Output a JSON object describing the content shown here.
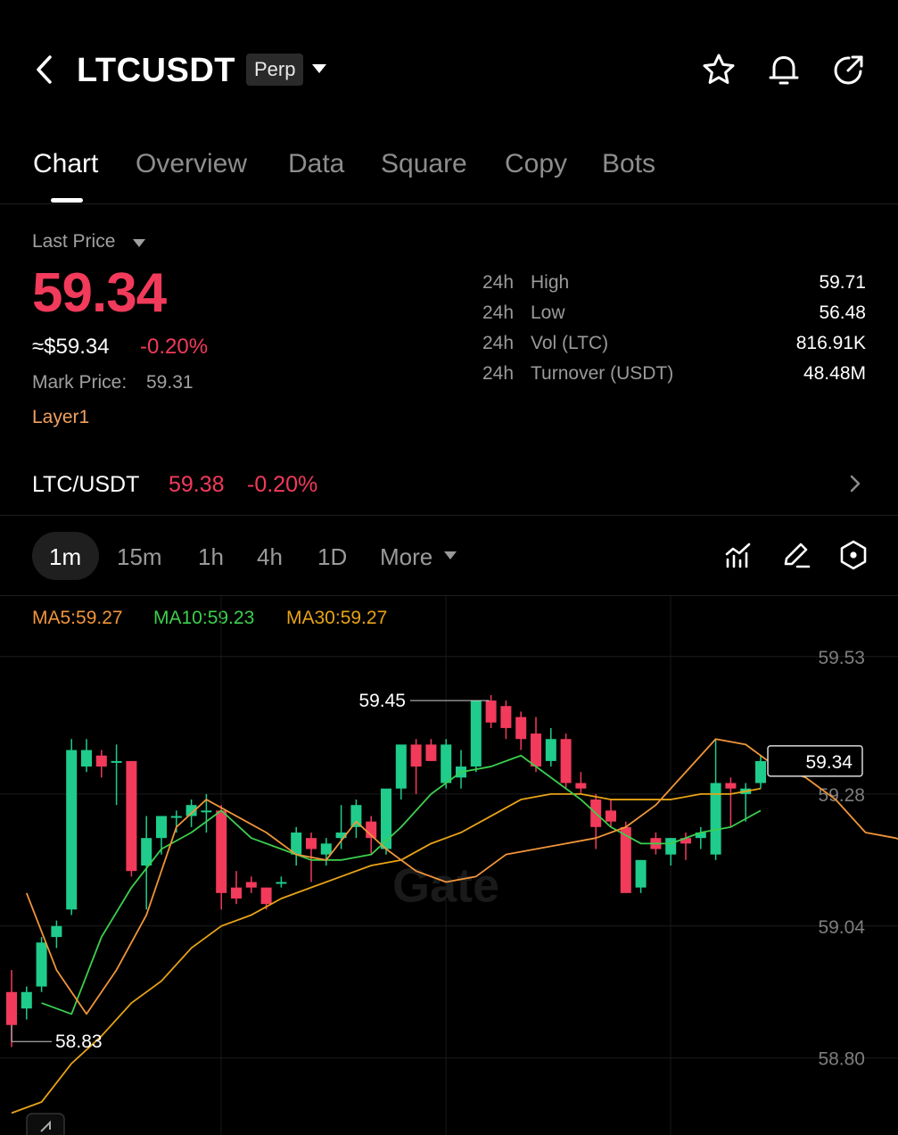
{
  "header": {
    "symbol": "LTCUSDT",
    "contract_type": "Perp",
    "icons": [
      "back-icon",
      "star-icon",
      "bell-icon",
      "share-icon"
    ]
  },
  "tabs": [
    {
      "label": "Chart",
      "active": true
    },
    {
      "label": "Overview",
      "active": false
    },
    {
      "label": "Data",
      "active": false
    },
    {
      "label": "Square",
      "active": false
    },
    {
      "label": "Copy",
      "active": false
    },
    {
      "label": "Bots",
      "active": false
    }
  ],
  "price": {
    "label": "Last Price",
    "last": "59.34",
    "usd": "≈$59.34",
    "change": "-0.20%",
    "mark_label": "Mark Price:",
    "mark_value": "59.31",
    "tag": "Layer1"
  },
  "stats": [
    {
      "prefix": "24h",
      "name": "High",
      "value": "59.71"
    },
    {
      "prefix": "24h",
      "name": "Low",
      "value": "56.48"
    },
    {
      "prefix": "24h",
      "name": "Vol (LTC)",
      "value": "816.91K"
    },
    {
      "prefix": "24h",
      "name": "Turnover (USDT)",
      "value": "48.48M"
    }
  ],
  "spot": {
    "pair": "LTC/USDT",
    "price": "59.38",
    "change": "-0.20%"
  },
  "intervals": [
    {
      "label": "1m",
      "active": true
    },
    {
      "label": "15m",
      "active": false
    },
    {
      "label": "1h",
      "active": false
    },
    {
      "label": "4h",
      "active": false
    },
    {
      "label": "1D",
      "active": false
    },
    {
      "label": "More",
      "active": false
    }
  ],
  "toolbar_icons": [
    "indicator-icon",
    "draw-icon",
    "settings-hexagon-icon"
  ],
  "ma_legend": [
    {
      "label": "MA5:59.27",
      "color": "#f0953a"
    },
    {
      "label": "MA10:59.23",
      "color": "#3ccf4e"
    },
    {
      "label": "MA30:59.27",
      "color": "#e8a317"
    }
  ],
  "colors": {
    "up": "#1fcc8b",
    "down": "#f23a5b",
    "accent_tag": "#f0a060"
  },
  "chart_data": {
    "type": "candlestick",
    "y_ticks": [
      "59.53",
      "59.28",
      "59.04",
      "58.80"
    ],
    "ylim": [
      58.66,
      59.64
    ],
    "current_price": "59.34",
    "high_marker": "59.45",
    "low_marker": "58.83",
    "watermark": "Gate",
    "candles": [
      {
        "o": 58.92,
        "h": 58.96,
        "l": 58.82,
        "c": 58.86
      },
      {
        "o": 58.89,
        "h": 58.93,
        "l": 58.87,
        "c": 58.92
      },
      {
        "o": 58.93,
        "h": 59.02,
        "l": 58.92,
        "c": 59.01
      },
      {
        "o": 59.02,
        "h": 59.05,
        "l": 59.0,
        "c": 59.04
      },
      {
        "o": 59.07,
        "h": 59.38,
        "l": 59.06,
        "c": 59.36
      },
      {
        "o": 59.33,
        "h": 59.38,
        "l": 59.32,
        "c": 59.36
      },
      {
        "o": 59.35,
        "h": 59.36,
        "l": 59.31,
        "c": 59.33
      },
      {
        "o": 59.34,
        "h": 59.37,
        "l": 59.26,
        "c": 59.34
      },
      {
        "o": 59.34,
        "h": 59.34,
        "l": 59.13,
        "c": 59.14
      },
      {
        "o": 59.15,
        "h": 59.24,
        "l": 59.07,
        "c": 59.2
      },
      {
        "o": 59.2,
        "h": 59.24,
        "l": 59.17,
        "c": 59.24
      },
      {
        "o": 59.24,
        "h": 59.25,
        "l": 59.21,
        "c": 59.24
      },
      {
        "o": 59.24,
        "h": 59.27,
        "l": 59.22,
        "c": 59.26
      },
      {
        "o": 59.25,
        "h": 59.28,
        "l": 59.21,
        "c": 59.25
      },
      {
        "o": 59.25,
        "h": 59.26,
        "l": 59.07,
        "c": 59.1
      },
      {
        "o": 59.11,
        "h": 59.14,
        "l": 59.08,
        "c": 59.09
      },
      {
        "o": 59.12,
        "h": 59.13,
        "l": 59.1,
        "c": 59.11
      },
      {
        "o": 59.11,
        "h": 59.11,
        "l": 59.07,
        "c": 59.08
      },
      {
        "o": 59.12,
        "h": 59.13,
        "l": 59.11,
        "c": 59.12
      },
      {
        "o": 59.17,
        "h": 59.22,
        "l": 59.15,
        "c": 59.21
      },
      {
        "o": 59.2,
        "h": 59.21,
        "l": 59.12,
        "c": 59.18
      },
      {
        "o": 59.17,
        "h": 59.2,
        "l": 59.15,
        "c": 59.19
      },
      {
        "o": 59.2,
        "h": 59.26,
        "l": 59.18,
        "c": 59.21
      },
      {
        "o": 59.22,
        "h": 59.27,
        "l": 59.2,
        "c": 59.26
      },
      {
        "o": 59.23,
        "h": 59.24,
        "l": 59.17,
        "c": 59.2
      },
      {
        "o": 59.18,
        "h": 59.27,
        "l": 59.17,
        "c": 59.29
      },
      {
        "o": 59.29,
        "h": 59.34,
        "l": 59.27,
        "c": 59.37
      },
      {
        "o": 59.37,
        "h": 59.38,
        "l": 59.28,
        "c": 59.33
      },
      {
        "o": 59.37,
        "h": 59.38,
        "l": 59.34,
        "c": 59.34
      },
      {
        "o": 59.3,
        "h": 59.38,
        "l": 59.29,
        "c": 59.37
      },
      {
        "o": 59.31,
        "h": 59.36,
        "l": 59.29,
        "c": 59.33
      },
      {
        "o": 59.33,
        "h": 59.45,
        "l": 59.32,
        "c": 59.45
      },
      {
        "o": 59.45,
        "h": 59.46,
        "l": 59.4,
        "c": 59.41
      },
      {
        "o": 59.44,
        "h": 59.45,
        "l": 59.38,
        "c": 59.4
      },
      {
        "o": 59.42,
        "h": 59.43,
        "l": 59.36,
        "c": 59.38
      },
      {
        "o": 59.39,
        "h": 59.42,
        "l": 59.32,
        "c": 59.33
      },
      {
        "o": 59.34,
        "h": 59.4,
        "l": 59.33,
        "c": 59.38
      },
      {
        "o": 59.38,
        "h": 59.39,
        "l": 59.29,
        "c": 59.3
      },
      {
        "o": 59.3,
        "h": 59.32,
        "l": 59.28,
        "c": 59.29
      },
      {
        "o": 59.27,
        "h": 59.28,
        "l": 59.18,
        "c": 59.22
      },
      {
        "o": 59.25,
        "h": 59.27,
        "l": 59.22,
        "c": 59.23
      },
      {
        "o": 59.22,
        "h": 59.23,
        "l": 59.1,
        "c": 59.1
      },
      {
        "o": 59.11,
        "h": 59.16,
        "l": 59.1,
        "c": 59.16
      },
      {
        "o": 59.2,
        "h": 59.21,
        "l": 59.17,
        "c": 59.18
      },
      {
        "o": 59.17,
        "h": 59.2,
        "l": 59.15,
        "c": 59.2
      },
      {
        "o": 59.2,
        "h": 59.21,
        "l": 59.16,
        "c": 59.19
      },
      {
        "o": 59.2,
        "h": 59.22,
        "l": 59.18,
        "c": 59.21
      },
      {
        "o": 59.17,
        "h": 59.38,
        "l": 59.16,
        "c": 59.3
      },
      {
        "o": 59.3,
        "h": 59.31,
        "l": 59.22,
        "c": 59.29
      },
      {
        "o": 59.28,
        "h": 59.3,
        "l": 59.23,
        "c": 59.29
      },
      {
        "o": 59.3,
        "h": 59.35,
        "l": 59.29,
        "c": 59.34
      }
    ],
    "ma5": [
      59.1,
      58.96,
      58.88,
      58.96,
      59.06,
      59.22,
      59.27,
      59.24,
      59.21,
      59.17,
      59.16,
      59.23,
      59.18,
      59.14,
      59.12,
      59.13,
      59.17,
      59.18,
      59.19,
      59.2,
      59.22,
      59.26,
      59.32,
      59.38,
      59.37,
      59.33,
      59.31,
      59.27,
      59.21,
      59.2,
      59.18,
      59.24,
      59.27
    ],
    "ma10": [
      58.9,
      58.88,
      59.02,
      59.11,
      59.18,
      59.21,
      59.25,
      59.2,
      59.18,
      59.16,
      59.16,
      59.17,
      59.22,
      59.28,
      59.32,
      59.33,
      59.35,
      59.31,
      59.27,
      59.22,
      59.19,
      59.19,
      59.21,
      59.22,
      59.25
    ],
    "ma30": [
      58.7,
      58.72,
      58.79,
      58.84,
      58.9,
      58.94,
      59.0,
      59.04,
      59.06,
      59.09,
      59.11,
      59.13,
      59.15,
      59.16,
      59.19,
      59.21,
      59.24,
      59.27,
      59.28,
      59.28,
      59.27,
      59.27,
      59.27,
      59.28,
      59.28,
      59.29
    ]
  }
}
